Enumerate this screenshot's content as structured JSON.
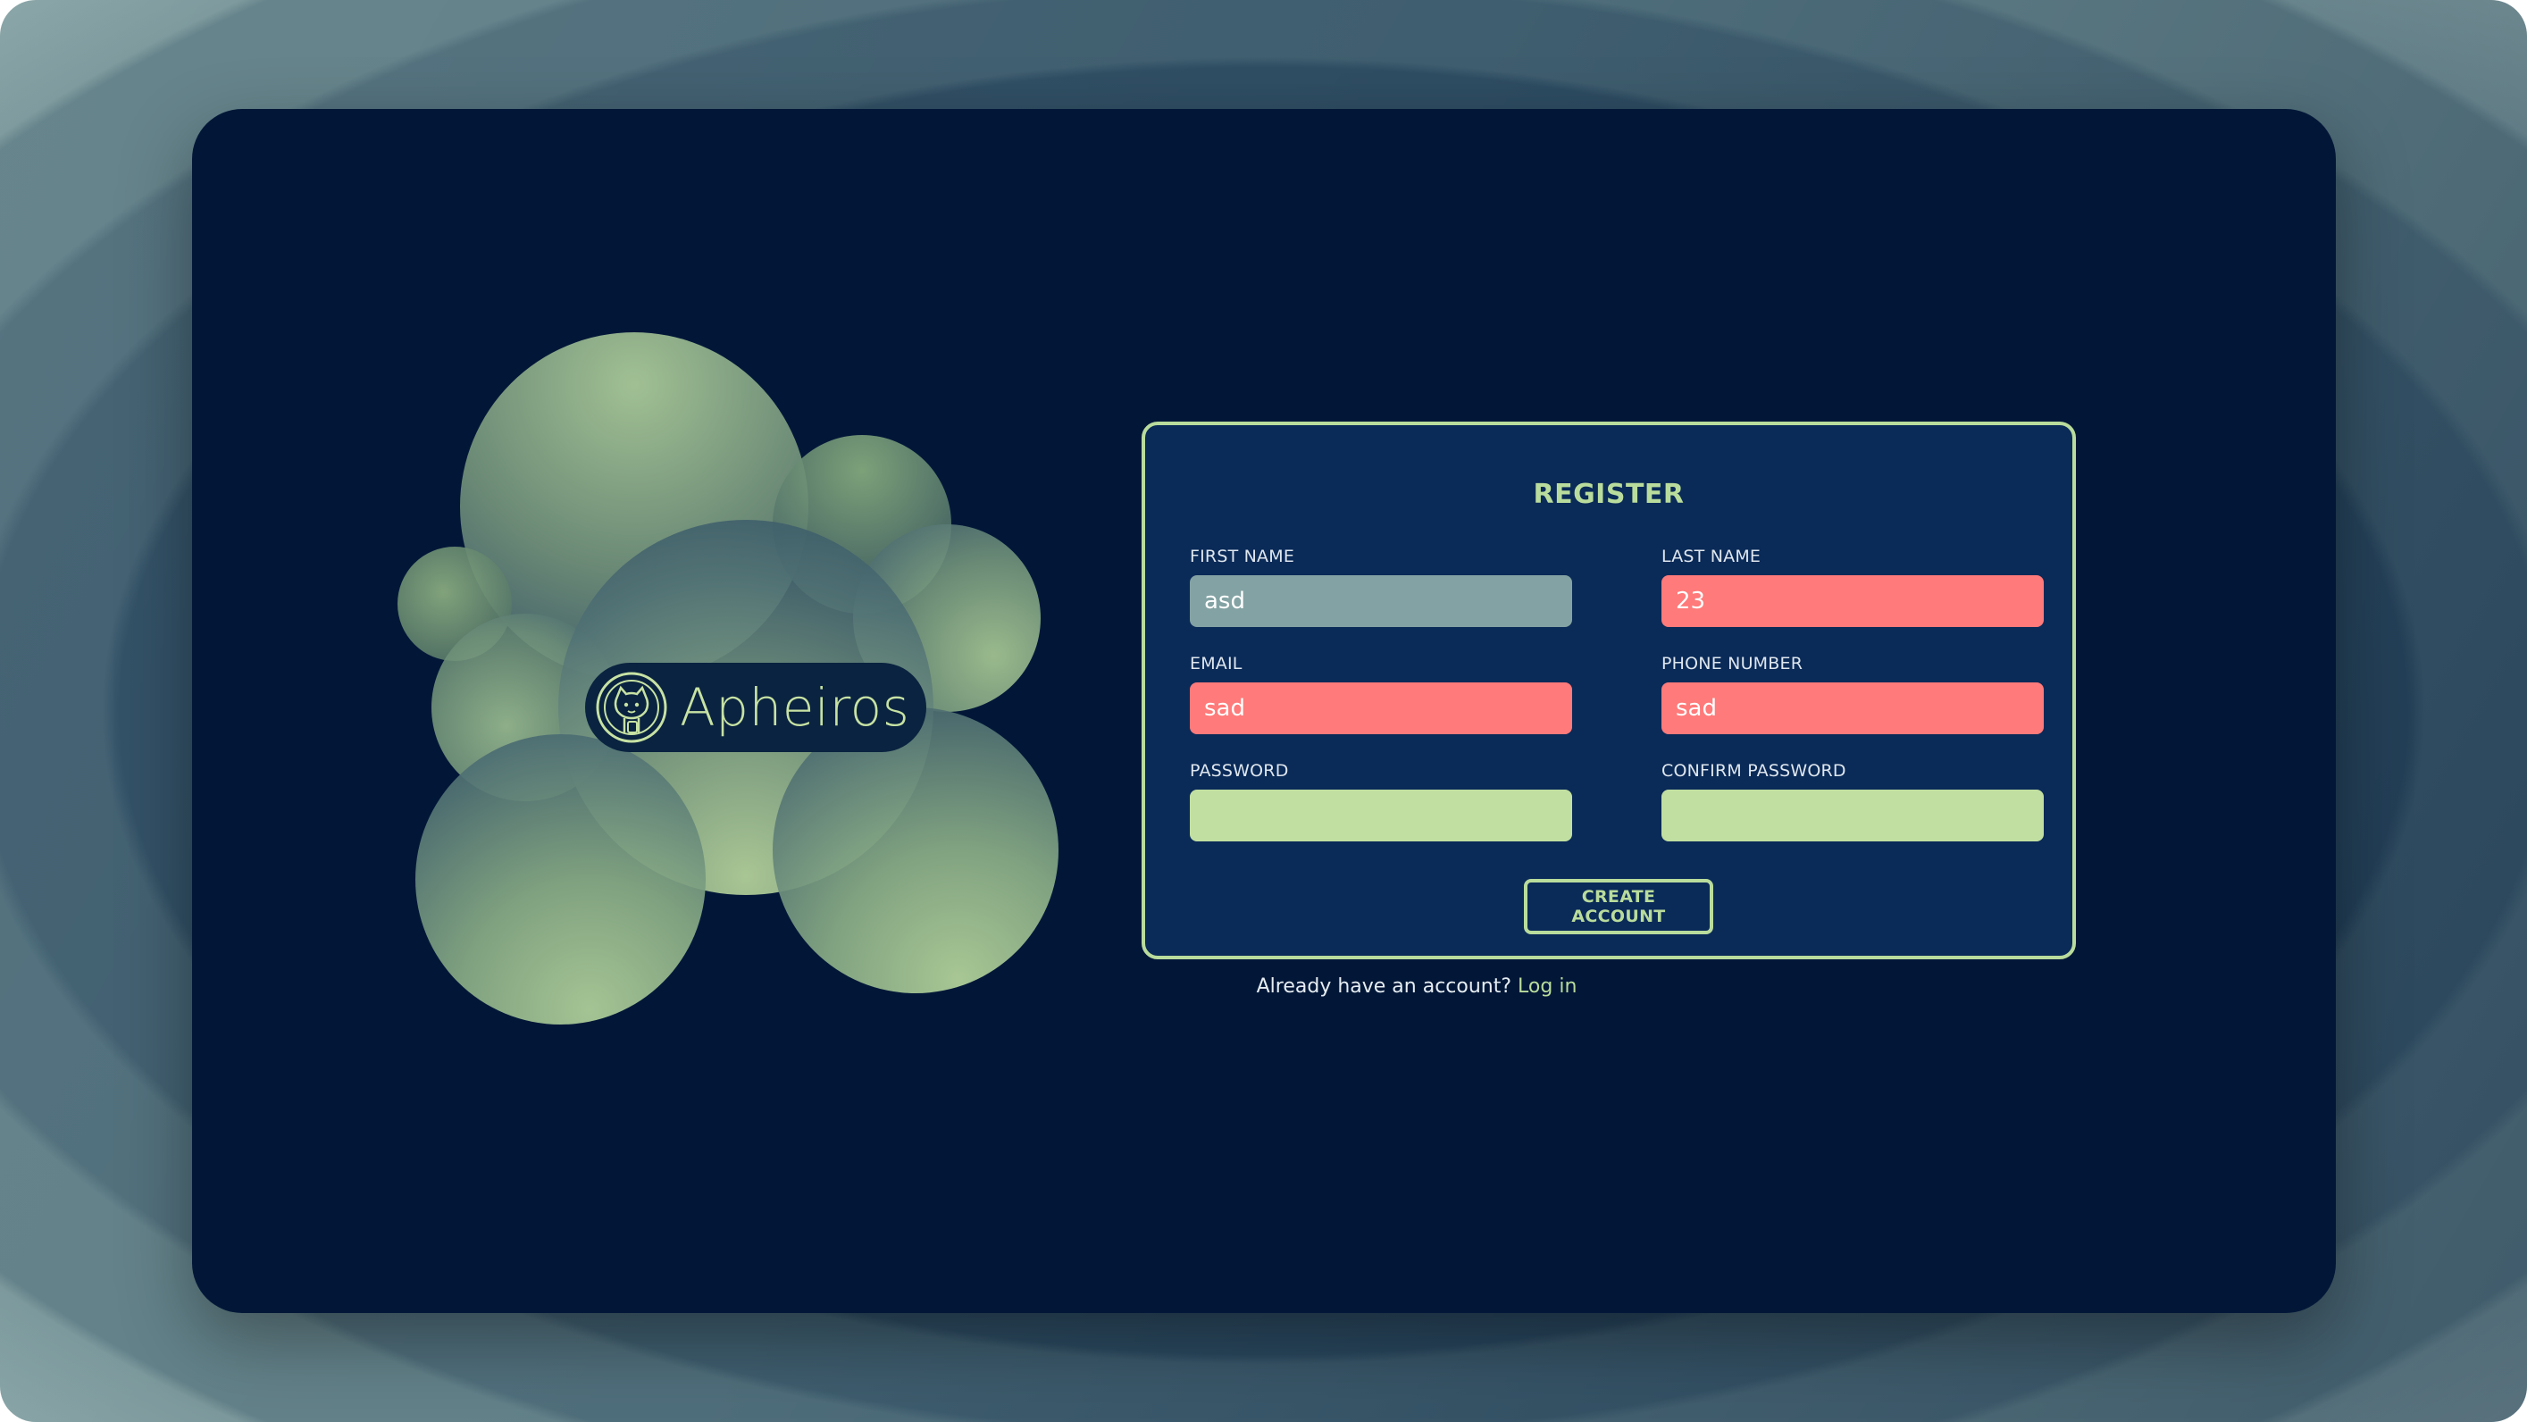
{
  "brand": {
    "logo_icon": "octocat-icon",
    "name": "Apheiros"
  },
  "form": {
    "title": "REGISTER",
    "fields": {
      "first_name": {
        "label": "FIRST NAME",
        "value": "asd",
        "state": "neutral"
      },
      "last_name": {
        "label": "LAST NAME",
        "value": "23",
        "state": "error"
      },
      "email": {
        "label": "EMAIL",
        "value": "sad",
        "state": "error"
      },
      "phone": {
        "label": "PHONE NUMBER",
        "value": "sad",
        "state": "error"
      },
      "password": {
        "label": "PASSWORD",
        "value": "",
        "state": "valid"
      },
      "confirm_password": {
        "label": "CONFIRM PASSWORD",
        "value": "",
        "state": "valid"
      }
    },
    "submit_label": "CREATE ACCOUNT"
  },
  "footer": {
    "prompt": "Already have an account?",
    "login_label": "Log in"
  },
  "colors": {
    "background": "#021738",
    "accent": "#b9dc9c",
    "error": "#ff7a7a",
    "neutral_input": "#83a2a3",
    "valid_input": "#c1dfa0"
  }
}
